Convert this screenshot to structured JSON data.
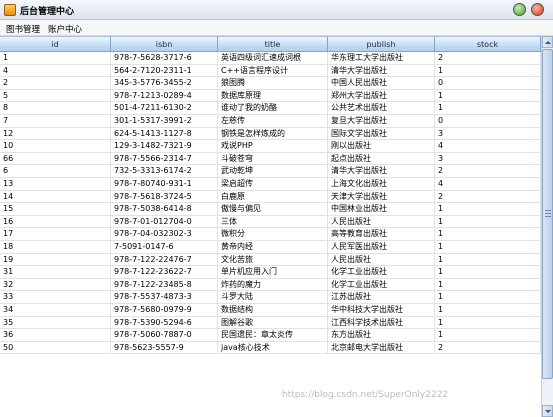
{
  "window": {
    "title": "后台管理中心"
  },
  "menu": {
    "books": "图书管理",
    "accounts": "账户中心"
  },
  "table": {
    "columns": [
      "id",
      "isbn",
      "title",
      "publish",
      "stock"
    ],
    "rows": [
      [
        "1",
        "978-7-5628-3717-6",
        "英语四级词汇速成词根",
        "华东理工大学出版社",
        "2"
      ],
      [
        "4",
        "564-2-7120-2311-1",
        "C++语言程序设计",
        "清华大学出版社",
        "1"
      ],
      [
        "2",
        "345-3-5776-3455-2",
        "狼图腾",
        "中国人民出版社",
        "0"
      ],
      [
        "5",
        "978-7-1213-0289-4",
        "数据库原理",
        "郑州大学出版社",
        "1"
      ],
      [
        "8",
        "501-4-7211-6130-2",
        "谁动了我的奶酪",
        "公共艺术出版社",
        "1"
      ],
      [
        "7",
        "301-1-5317-3991-2",
        "左慈传",
        "复旦大学出版社",
        "0"
      ],
      [
        "12",
        "624-5-1413-1127-8",
        "钢铁是怎样炼成的",
        "国际文学出版社",
        "3"
      ],
      [
        "10",
        "129-3-1482-7321-9",
        "戏说PHP",
        "刚以出版社",
        "4"
      ],
      [
        "66",
        "978-7-5566-2314-7",
        "斗破苍穹",
        "起点出版社",
        "3"
      ],
      [
        "6",
        "732-5-3313-6174-2",
        "武动乾坤",
        "清华大学出版社",
        "2"
      ],
      [
        "13",
        "978-7-80740-931-1",
        "梁启超传",
        "上海文化出版社",
        "4"
      ],
      [
        "14",
        "978-7-5618-3724-5",
        "白鹿原",
        "天津大学出版社",
        "2"
      ],
      [
        "15",
        "978-7-5038-6414-8",
        "傲慢与偏见",
        "中国林业出版社",
        "1"
      ],
      [
        "16",
        "978-7-01-012704-0",
        "三体",
        "人民出版社",
        "1"
      ],
      [
        "17",
        "978-7-04-032302-3",
        "微积分",
        "高等教育出版社",
        "1"
      ],
      [
        "18",
        "7-5091-0147-6",
        "黄帝内经",
        "人民军医出版社",
        "1"
      ],
      [
        "19",
        "978-7-122-22476-7",
        "文化苦旅",
        "人民出版社",
        "1"
      ],
      [
        "31",
        "978-7-122-23622-7",
        "单片机应用入门",
        "化学工业出版社",
        "1"
      ],
      [
        "32",
        "978-7-122-23485-8",
        "炸药的魔力",
        "化学工业出版社",
        "1"
      ],
      [
        "33",
        "978-7-5537-4873-3",
        "斗罗大陆",
        "江苏出版社",
        "1"
      ],
      [
        "34",
        "978-7-5680-0979-9",
        "数据结构",
        "华中科技大学出版社",
        "1"
      ],
      [
        "35",
        "978-7-5390-5294-6",
        "图解谷歌",
        "江西科学技术出版社",
        "1"
      ],
      [
        "36",
        "978-7-5060-7887-0",
        "民国遗民：章太炎传",
        "东方出版社",
        "1"
      ],
      [
        "50",
        "978-5623-5557-9",
        "java核心技术",
        "北京邮电大学出版社",
        "2"
      ]
    ]
  },
  "watermark": "https://blog.csdn.net/SuperOnly2222"
}
